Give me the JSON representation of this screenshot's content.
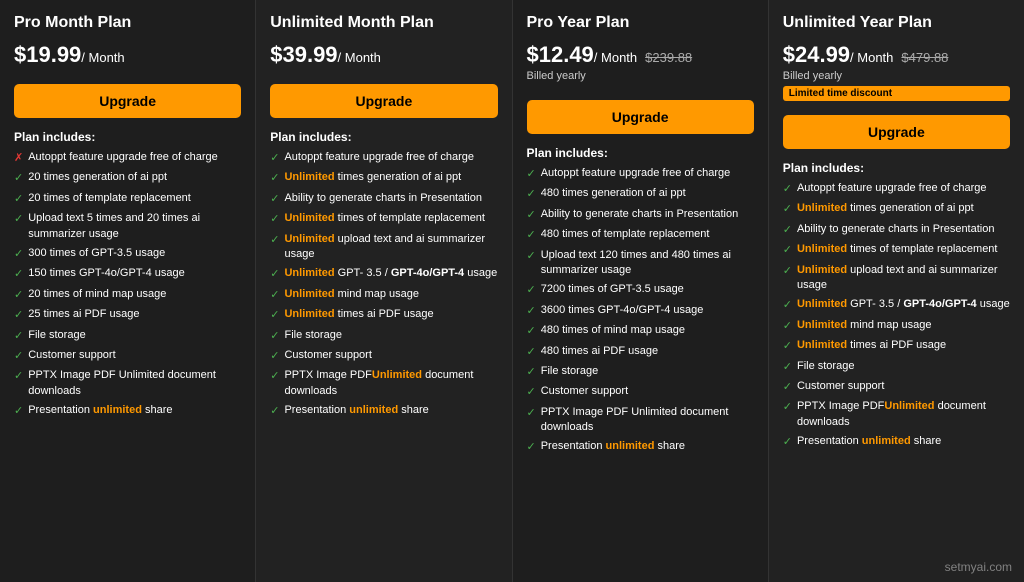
{
  "plans": [
    {
      "id": "pro-month",
      "title": "Pro Month Plan",
      "price": "$19.99",
      "per": "/ Month",
      "original_price": null,
      "billed_yearly": null,
      "discount_badge": null,
      "upgrade_label": "Upgrade",
      "includes_title": "Plan includes:",
      "features": [
        {
          "icon": "cross",
          "text": "Autoppt feature upgrade free of charge"
        },
        {
          "icon": "check",
          "text": "20 times generation of ai ppt"
        },
        {
          "icon": "check",
          "text": "20 times of template replacement"
        },
        {
          "icon": "check",
          "text": "Upload text 5 times and 20 times ai summarizer usage"
        },
        {
          "icon": "check",
          "text": "300 times of GPT-3.5 usage"
        },
        {
          "icon": "check",
          "text": "150 times GPT-4o/GPT-4 usage"
        },
        {
          "icon": "check",
          "text": "20 times of mind map usage"
        },
        {
          "icon": "check",
          "text": "25 times ai PDF usage"
        },
        {
          "icon": "check",
          "text": "File storage"
        },
        {
          "icon": "check",
          "text": "Customer support"
        },
        {
          "icon": "check",
          "text": "PPTX Image PDF Unlimited document downloads"
        },
        {
          "icon": "check",
          "text": "Presentation unlimited share"
        }
      ]
    },
    {
      "id": "unlimited-month",
      "title": "Unlimited Month Plan",
      "price": "$39.99",
      "per": "/ Month",
      "original_price": null,
      "billed_yearly": null,
      "discount_badge": null,
      "upgrade_label": "Upgrade",
      "includes_title": "Plan includes:",
      "features": [
        {
          "icon": "check",
          "text": "Autoppt feature upgrade free of charge",
          "unlimited": false
        },
        {
          "icon": "check",
          "text": "times generation of ai ppt",
          "unlimited": true,
          "unlimited_prefix": "Unlimited "
        },
        {
          "icon": "check",
          "text": "Ability to generate charts in Presentation",
          "unlimited": false
        },
        {
          "icon": "check",
          "text": "times of template replacement",
          "unlimited": true,
          "unlimited_prefix": "Unlimited "
        },
        {
          "icon": "check",
          "text": "upload text and ai summarizer usage",
          "unlimited": true,
          "unlimited_prefix": "Unlimited "
        },
        {
          "icon": "check",
          "text": "GPT- 3.5 / GPT-4o/GPT-4 usage",
          "unlimited": true,
          "unlimited_prefix": "Unlimited ",
          "bold_part": "GPT-4o/GPT-4"
        },
        {
          "icon": "check",
          "text": "mind map usage",
          "unlimited": true,
          "unlimited_prefix": "Unlimited "
        },
        {
          "icon": "check",
          "text": "times ai PDF usage",
          "unlimited": true,
          "unlimited_prefix": "Unlimited "
        },
        {
          "icon": "check",
          "text": "File storage",
          "unlimited": false
        },
        {
          "icon": "check",
          "text": "Customer support",
          "unlimited": false
        },
        {
          "icon": "check",
          "text": "PPTX Image PDFUnlimited document downloads",
          "unlimited": false
        },
        {
          "icon": "check",
          "text": "Presentation unlimited share",
          "unlimited": false
        }
      ]
    },
    {
      "id": "pro-year",
      "title": "Pro Year Plan",
      "price": "$12.49",
      "per": "/ Month",
      "original_price": "$239.88",
      "billed_yearly": "Billed yearly",
      "discount_badge": null,
      "upgrade_label": "Upgrade",
      "includes_title": "Plan includes:",
      "features": [
        {
          "icon": "check",
          "text": "Autoppt feature upgrade free of charge"
        },
        {
          "icon": "check",
          "text": "480 times generation of ai ppt"
        },
        {
          "icon": "check",
          "text": "Ability to generate charts in Presentation"
        },
        {
          "icon": "check",
          "text": "480 times of template replacement"
        },
        {
          "icon": "check",
          "text": "Upload text 120 times and 480 times ai summarizer usage"
        },
        {
          "icon": "check",
          "text": "7200 times of GPT-3.5 usage"
        },
        {
          "icon": "check",
          "text": "3600 times GPT-4o/GPT-4 usage"
        },
        {
          "icon": "check",
          "text": "480 times of mind map usage"
        },
        {
          "icon": "check",
          "text": "480 times ai PDF usage"
        },
        {
          "icon": "check",
          "text": "File storage"
        },
        {
          "icon": "check",
          "text": "Customer support"
        },
        {
          "icon": "check",
          "text": "PPTX Image PDF Unlimited document downloads"
        },
        {
          "icon": "check",
          "text": "Presentation unlimited share"
        }
      ]
    },
    {
      "id": "unlimited-year",
      "title": "Unlimited Year Plan",
      "price": "$24.99",
      "per": "/ Month",
      "original_price": "$479.88",
      "billed_yearly": "Billed yearly",
      "discount_badge": "Limited time discount",
      "upgrade_label": "Upgrade",
      "includes_title": "Plan includes:",
      "features": [
        {
          "icon": "check",
          "text": "Autoppt feature upgrade free of charge",
          "unlimited": false
        },
        {
          "icon": "check",
          "text": "times generation of ai ppt",
          "unlimited": true,
          "unlimited_prefix": "Unlimited "
        },
        {
          "icon": "check",
          "text": "Ability to generate charts in Presentation",
          "unlimited": false
        },
        {
          "icon": "check",
          "text": "times of template replacement",
          "unlimited": true,
          "unlimited_prefix": "Unlimited "
        },
        {
          "icon": "check",
          "text": "upload text and ai summarizer usage",
          "unlimited": true,
          "unlimited_prefix": "Unlimited "
        },
        {
          "icon": "check",
          "text": "GPT- 3.5 / GPT-4o/GPT-4 usage",
          "unlimited": true,
          "unlimited_prefix": "Unlimited ",
          "bold_part": "GPT-4o/GPT-4"
        },
        {
          "icon": "check",
          "text": "mind map usage",
          "unlimited": true,
          "unlimited_prefix": "Unlimited "
        },
        {
          "icon": "check",
          "text": "times ai PDF usage",
          "unlimited": true,
          "unlimited_prefix": "Unlimited "
        },
        {
          "icon": "check",
          "text": "File storage",
          "unlimited": false
        },
        {
          "icon": "check",
          "text": "Customer support",
          "unlimited": false
        },
        {
          "icon": "check",
          "text": "PPTX Image PDFUnlimited document downloads",
          "unlimited": false
        },
        {
          "icon": "check",
          "text": "Presentation unlimited share",
          "unlimited": false
        }
      ]
    }
  ],
  "watermark": "setmyai.com"
}
